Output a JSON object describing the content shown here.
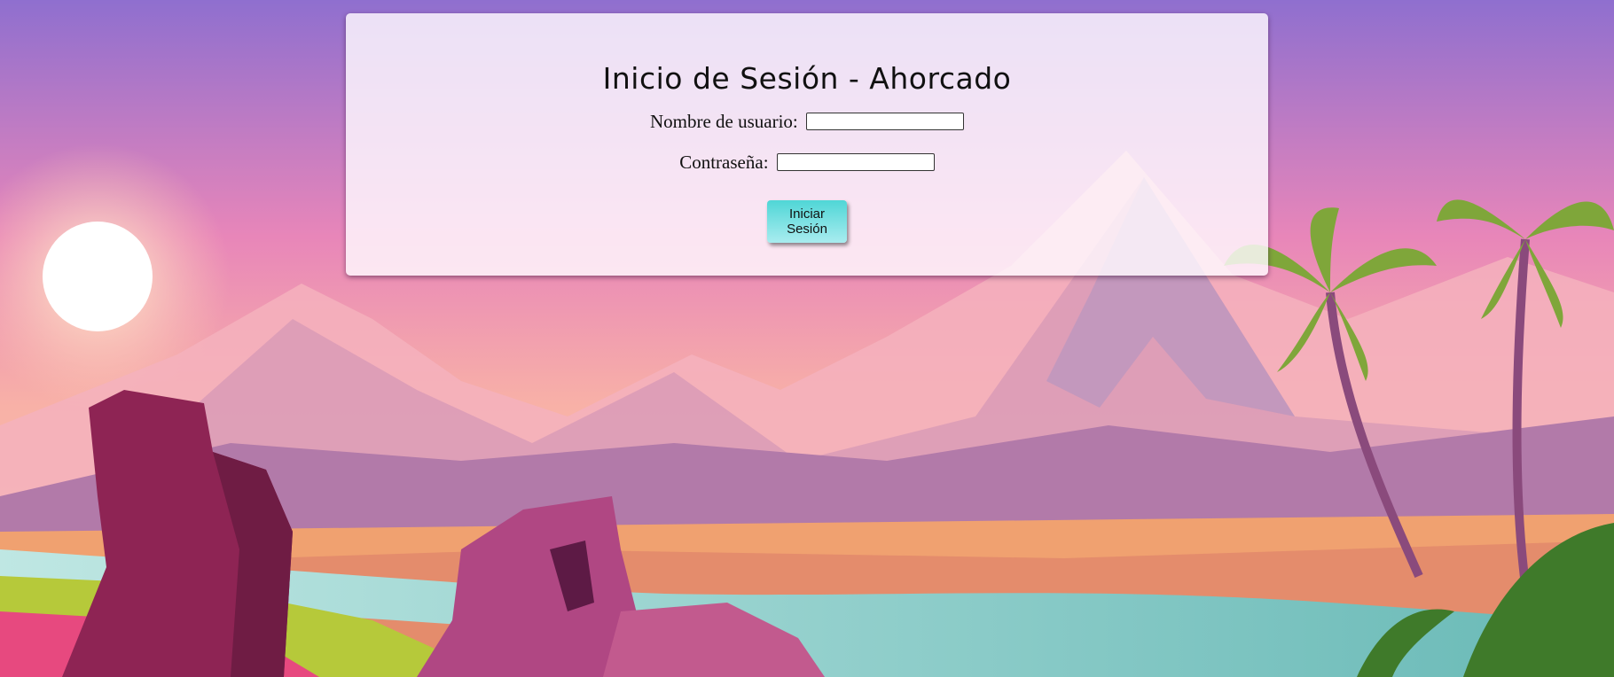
{
  "login": {
    "title": "Inicio de Sesión - Ahorcado",
    "username_label": "Nombre de usuario:",
    "username_value": "",
    "password_label": "Contraseña:",
    "password_value": "",
    "submit_label": "Iniciar Sesión"
  },
  "colors": {
    "button_top": "#4fd6d6",
    "button_bottom": "#a9ecef",
    "sky_top": "#8f6fcf",
    "sky_bottom": "#f7a3b8",
    "sun": "#ffffff"
  },
  "background": {
    "icon": "tropical-landscape-illustration"
  }
}
